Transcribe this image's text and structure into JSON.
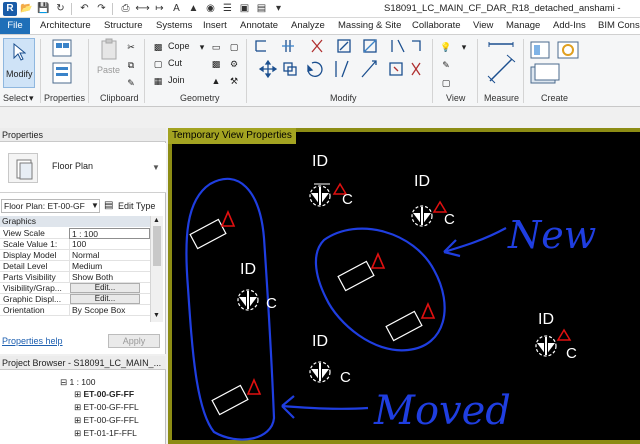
{
  "title_bar": {
    "app_letter": "R",
    "document_title": "S18091_LC_MAIN_CF_DAR_R18_detached_anshami -"
  },
  "ribbon": {
    "tabs": [
      "File",
      "Architecture",
      "Structure",
      "Systems",
      "Insert",
      "Annotate",
      "Analyze",
      "Massing & Site",
      "Collaborate",
      "View",
      "Manage",
      "Add-Ins",
      "BIM Cons"
    ],
    "panels": {
      "select": "Select",
      "properties": "Properties",
      "clipboard": "Clipboard",
      "geometry": "Geometry",
      "modify": "Modify",
      "view": "View",
      "measure": "Measure",
      "create": "Create"
    },
    "commands": {
      "modify": "Modify",
      "paste": "Paste",
      "cope": "Cope",
      "cut": "Cut",
      "join": "Join"
    }
  },
  "properties_palette": {
    "header": "Properties",
    "type_name": "Floor Plan",
    "instance_selector": "Floor Plan: ET-00-GF",
    "edit_type": "Edit Type",
    "group": "Graphics",
    "rows": [
      {
        "name": "View Scale",
        "value": "1 : 100"
      },
      {
        "name": "Scale Value   1:",
        "value": "100"
      },
      {
        "name": "Display Model",
        "value": "Normal"
      },
      {
        "name": "Detail Level",
        "value": "Medium"
      },
      {
        "name": "Parts Visibility",
        "value": "Show Both"
      },
      {
        "name": "Visibility/Grap...",
        "value": "Edit..."
      },
      {
        "name": "Graphic Displ...",
        "value": "Edit..."
      },
      {
        "name": "Orientation",
        "value": "By Scope Box"
      }
    ],
    "help_link": "Properties help",
    "apply": "Apply"
  },
  "project_browser": {
    "header": "Project Browser - S18091_LC_MAIN_...",
    "items": [
      {
        "label": "1 : 100",
        "expander": "⊟"
      },
      {
        "label": "ET-00-GF-FF",
        "expander": "⊞"
      },
      {
        "label": "ET-00-GF-FFL",
        "expander": "⊞"
      },
      {
        "label": "ET-00-GF-FFL",
        "expander": "⊞"
      },
      {
        "label": "ET-01-1F-FFL",
        "expander": "⊞"
      }
    ]
  },
  "drawing": {
    "banner": "Temporary View Properties",
    "symbol_tag_id": "ID",
    "symbol_tag_c": "C",
    "annotation_new": "New",
    "annotation_moved": "Moved",
    "colors": {
      "background": "#000000",
      "frame": "#8c8c14",
      "banner": "#a3a321",
      "markup_blue": "#1f3ee0",
      "triangle_red": "#e01010",
      "linework": "#ffffff"
    }
  }
}
